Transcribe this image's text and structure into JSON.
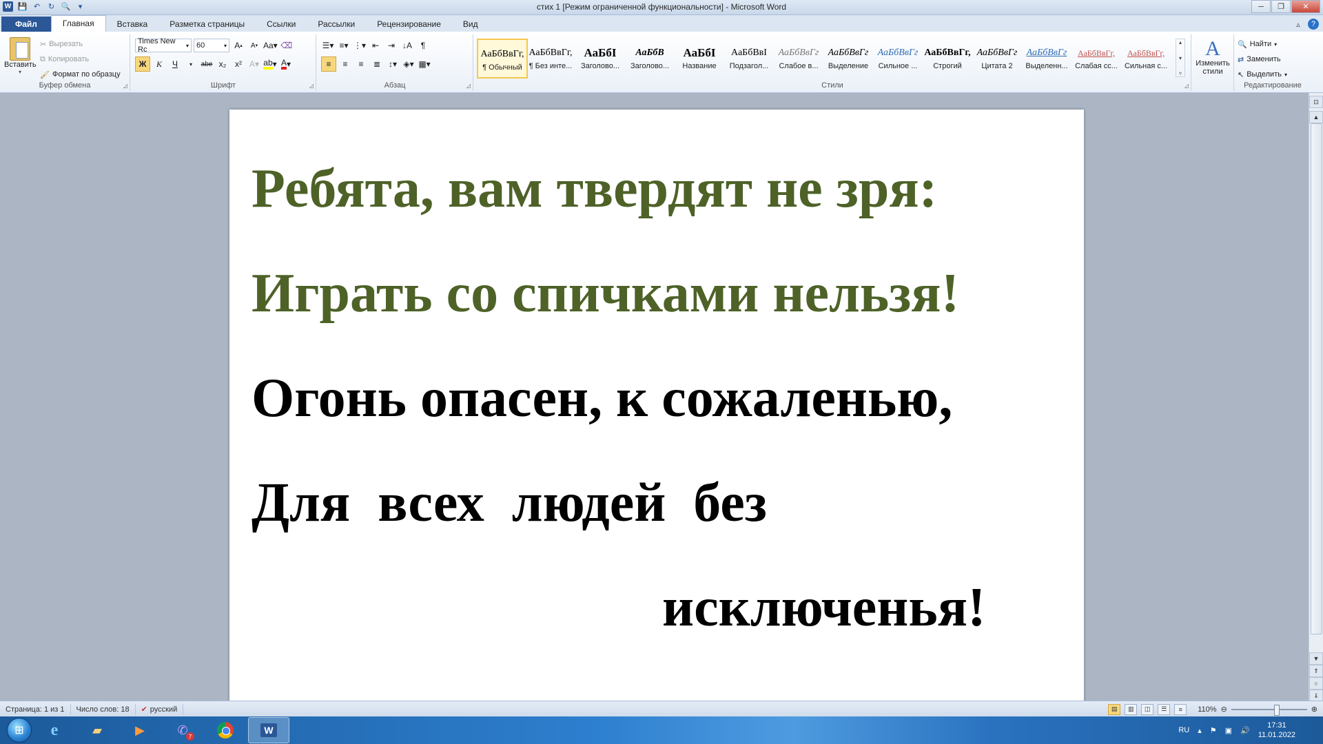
{
  "window": {
    "title": "стих 1 [Режим ограниченной функциональности] - Microsoft Word",
    "app_logo": "W",
    "buttons": [
      "─",
      "❐",
      "✕"
    ]
  },
  "tabs": [
    {
      "label": "Файл"
    },
    {
      "label": "Главная"
    },
    {
      "label": "Вставка"
    },
    {
      "label": "Разметка страницы"
    },
    {
      "label": "Ссылки"
    },
    {
      "label": "Рассылки"
    },
    {
      "label": "Рецензирование"
    },
    {
      "label": "Вид"
    }
  ],
  "clipboard": {
    "label": "Буфер обмена",
    "paste": "Вставить",
    "cut": "Вырезать",
    "copy": "Копировать",
    "format_painter": "Формат по образцу"
  },
  "font": {
    "label": "Шрифт",
    "family": "Times New Rc",
    "size": "60",
    "bold": "Ж",
    "italic": "К",
    "underline": "Ч",
    "strike": "abe",
    "sub": "x₂",
    "sup": "x²"
  },
  "paragraph": {
    "label": "Абзац"
  },
  "styles": {
    "label": "Стили",
    "items": [
      {
        "sample": "АаБбВвГг,",
        "name": "¶ Обычный",
        "color": "#000000"
      },
      {
        "sample": "АаБбВвГг,",
        "name": "¶ Без инте...",
        "color": "#000000"
      },
      {
        "sample": "АаБбІ",
        "name": "Заголово...",
        "color": "#000000"
      },
      {
        "sample": "АаБбВ",
        "name": "Заголово...",
        "color": "#000000"
      },
      {
        "sample": "АаБбІ",
        "name": "Название",
        "color": "#000000"
      },
      {
        "sample": "АаБбВвІ",
        "name": "Подзагол...",
        "color": "#000000"
      },
      {
        "sample": "АаБбВвГг",
        "name": "Слабое в...",
        "color": "#777777"
      },
      {
        "sample": "АаБбВвГг",
        "name": "Выделение",
        "color": "#000000"
      },
      {
        "sample": "АаБбВвГг",
        "name": "Сильное ...",
        "color": "#2f6db5"
      },
      {
        "sample": "АаБбВвГг,",
        "name": "Строгий",
        "color": "#000000"
      },
      {
        "sample": "АаБбВвГг",
        "name": "Цитата 2",
        "color": "#000000"
      },
      {
        "sample": "АаБбВвГг",
        "name": "Выделенн...",
        "color": "#2f6db5"
      },
      {
        "sample": "АаБбВвГг,",
        "name": "Слабая сс...",
        "color": "#c0504d"
      },
      {
        "sample": "АаБбВвГг,",
        "name": "Сильная с...",
        "color": "#c0504d"
      }
    ],
    "change": "Изменить стили"
  },
  "editing": {
    "label": "Редактирование",
    "find": "Найти",
    "replace": "Заменить",
    "select": "Выделить"
  },
  "document": {
    "lines": [
      {
        "text": "Ребята, вам твердят не зря:",
        "color": "#4e6228"
      },
      {
        "text": "Играть со спичками нельзя!",
        "color": "#4e6228"
      },
      {
        "text": "Огонь опасен, к сожаленью,",
        "color": "#000000"
      },
      {
        "text": "Для  всех  людей  без",
        "color": "#000000"
      },
      {
        "text": "исключенья!",
        "color": "#000000"
      }
    ]
  },
  "status": {
    "page": "Страница: 1 из 1",
    "words": "Число слов: 18",
    "lang": "русский",
    "zoom": "110%"
  },
  "taskbar": {
    "lang": "RU",
    "time": "17:31",
    "date": "11.01.2022",
    "viber_badge": "7"
  }
}
